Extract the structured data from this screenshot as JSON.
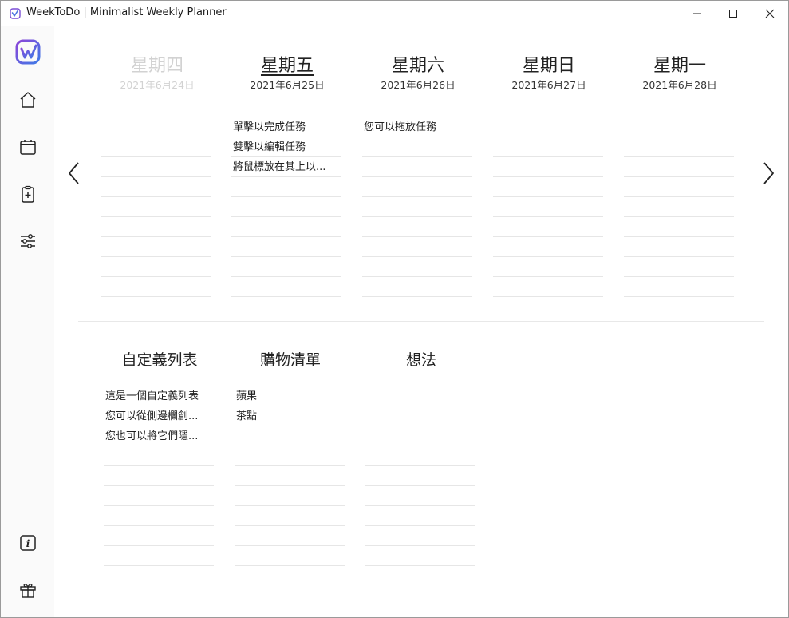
{
  "window": {
    "title": "WeekToDo | Minimalist Weekly Planner"
  },
  "sidebar": {
    "items": [
      {
        "name": "home-icon"
      },
      {
        "name": "calendar-icon"
      },
      {
        "name": "add-list-icon"
      },
      {
        "name": "settings-sliders-icon"
      },
      {
        "name": "info-icon"
      },
      {
        "name": "gift-icon"
      }
    ]
  },
  "week": {
    "days": [
      {
        "name": "星期四",
        "date": "2021年6月24日",
        "state": "past",
        "tasks": []
      },
      {
        "name": "星期五",
        "date": "2021年6月25日",
        "state": "today",
        "tasks": [
          "單擊以完成任務",
          "雙擊以編輯任務",
          "將鼠標放在其上以..."
        ]
      },
      {
        "name": "星期六",
        "date": "2021年6月26日",
        "state": "future",
        "tasks": [
          "您可以拖放任務"
        ]
      },
      {
        "name": "星期日",
        "date": "2021年6月27日",
        "state": "future",
        "tasks": []
      },
      {
        "name": "星期一",
        "date": "2021年6月28日",
        "state": "future",
        "tasks": []
      }
    ]
  },
  "custom_lists": [
    {
      "title": "自定義列表",
      "tasks": [
        "這是一個自定義列表",
        "您可以從側邊欄創...",
        "您也可以將它們隱..."
      ]
    },
    {
      "title": "購物清單",
      "tasks": [
        "蘋果",
        "茶點"
      ]
    },
    {
      "title": "想法",
      "tasks": []
    }
  ],
  "colors": {
    "accent_purple": "#7b4fd6",
    "accent_blue": "#4a74e0",
    "past_text": "#d2d2d2",
    "line": "#e6e6e6"
  }
}
